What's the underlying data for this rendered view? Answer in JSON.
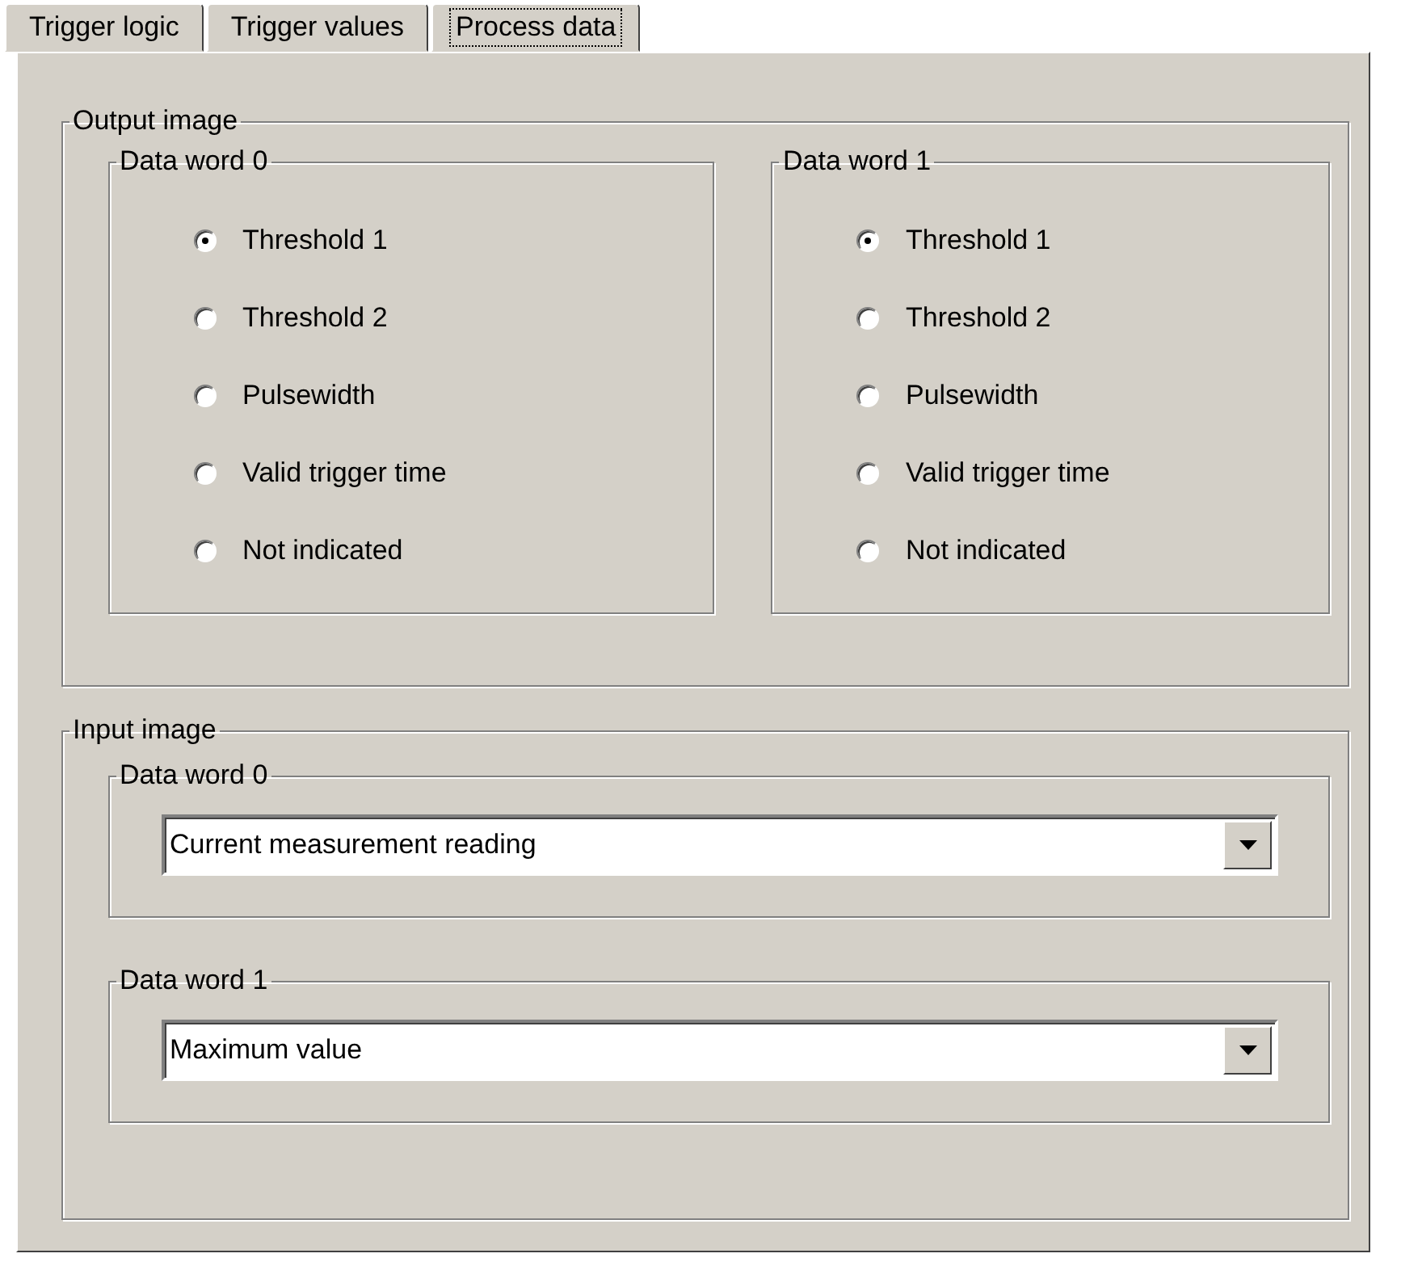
{
  "tabs": [
    {
      "label": "Trigger logic",
      "selected": false
    },
    {
      "label": "Trigger values",
      "selected": false
    },
    {
      "label": "Process data",
      "selected": true
    }
  ],
  "output_image": {
    "title": "Output image",
    "groups": [
      {
        "title": "Data word 0",
        "options": [
          {
            "label": "Threshold 1",
            "selected": true
          },
          {
            "label": "Threshold 2",
            "selected": false
          },
          {
            "label": "Pulsewidth",
            "selected": false
          },
          {
            "label": "Valid trigger time",
            "selected": false
          },
          {
            "label": "Not indicated",
            "selected": false
          }
        ]
      },
      {
        "title": "Data word 1",
        "options": [
          {
            "label": "Threshold 1",
            "selected": true
          },
          {
            "label": "Threshold 2",
            "selected": false
          },
          {
            "label": "Pulsewidth",
            "selected": false
          },
          {
            "label": "Valid trigger time",
            "selected": false
          },
          {
            "label": "Not indicated",
            "selected": false
          }
        ]
      }
    ]
  },
  "input_image": {
    "title": "Input image",
    "groups": [
      {
        "title": "Data word 0",
        "value": "Current measurement reading"
      },
      {
        "title": "Data word 1",
        "value": "Maximum value"
      }
    ]
  }
}
